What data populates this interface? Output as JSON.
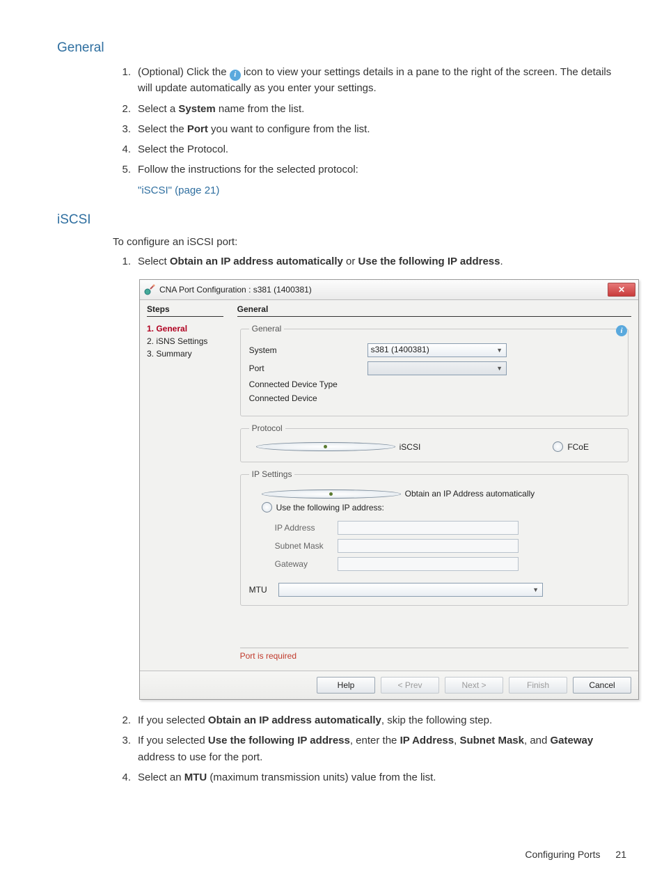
{
  "doc": {
    "section_general": "General",
    "section_iscsi": "iSCSI",
    "intro_iscsi": "To configure an iSCSI port:",
    "link_iscsi": "\"iSCSI\" (page 21)",
    "footer_title": "Configuring Ports",
    "footer_page": "21"
  },
  "step1": {
    "num": "1.",
    "pre": "(Optional) Click the ",
    "post": " icon to view your settings details in a pane to the right of the screen. The details will update automatically as you enter your settings."
  },
  "step2": {
    "num": "2.",
    "pre": "Select a ",
    "b": "System",
    "post": " name from the list."
  },
  "step3": {
    "num": "3.",
    "pre": "Select the ",
    "b": "Port",
    "post": " you want to configure from the list."
  },
  "step4": {
    "num": "4.",
    "text": "Select the Protocol."
  },
  "step5": {
    "num": "5.",
    "text": "Follow the instructions for the selected protocol:"
  },
  "istep1": {
    "num": "1.",
    "pre": "Select ",
    "b1": "Obtain an IP address automatically",
    "mid": " or ",
    "b2": "Use the following IP address",
    "post": "."
  },
  "istep2": {
    "num": "2.",
    "pre": "If you selected ",
    "b": "Obtain an IP address automatically",
    "post": ", skip the following step."
  },
  "istep3": {
    "num": "3.",
    "pre": "If you selected ",
    "b1": "Use the following IP address",
    "mid1": ", enter the ",
    "b2": "IP Address",
    "mid2": ", ",
    "b3": "Subnet Mask",
    "mid3": ", and ",
    "b4": "Gateway",
    "post": " address to use for the port."
  },
  "istep4": {
    "num": "4.",
    "pre": "Select an ",
    "b": "MTU",
    "post": " (maximum transmission units) value from the list."
  },
  "dialog": {
    "title": "CNA Port Configuration : s381 (1400381)",
    "left_header": "Steps",
    "right_header": "General",
    "steps": {
      "s1": "1. General",
      "s2": "2. iSNS Settings",
      "s3": "3. Summary"
    },
    "general": {
      "legend": "General",
      "system_label": "System",
      "system_value": "s381 (1400381)",
      "port_label": "Port",
      "cdt_label": "Connected Device Type",
      "cd_label": "Connected Device"
    },
    "protocol": {
      "legend": "Protocol",
      "iscsi": "iSCSI",
      "fcoe": "FCoE"
    },
    "ip": {
      "legend": "IP Settings",
      "obtain": "Obtain an IP Address automatically",
      "use": "Use the following IP address:",
      "ip_label": "IP Address",
      "mask_label": "Subnet Mask",
      "gw_label": "Gateway",
      "mtu_label": "MTU"
    },
    "validation": "Port is required",
    "buttons": {
      "help": "Help",
      "prev": "< Prev",
      "next": "Next >",
      "finish": "Finish",
      "cancel": "Cancel"
    }
  }
}
